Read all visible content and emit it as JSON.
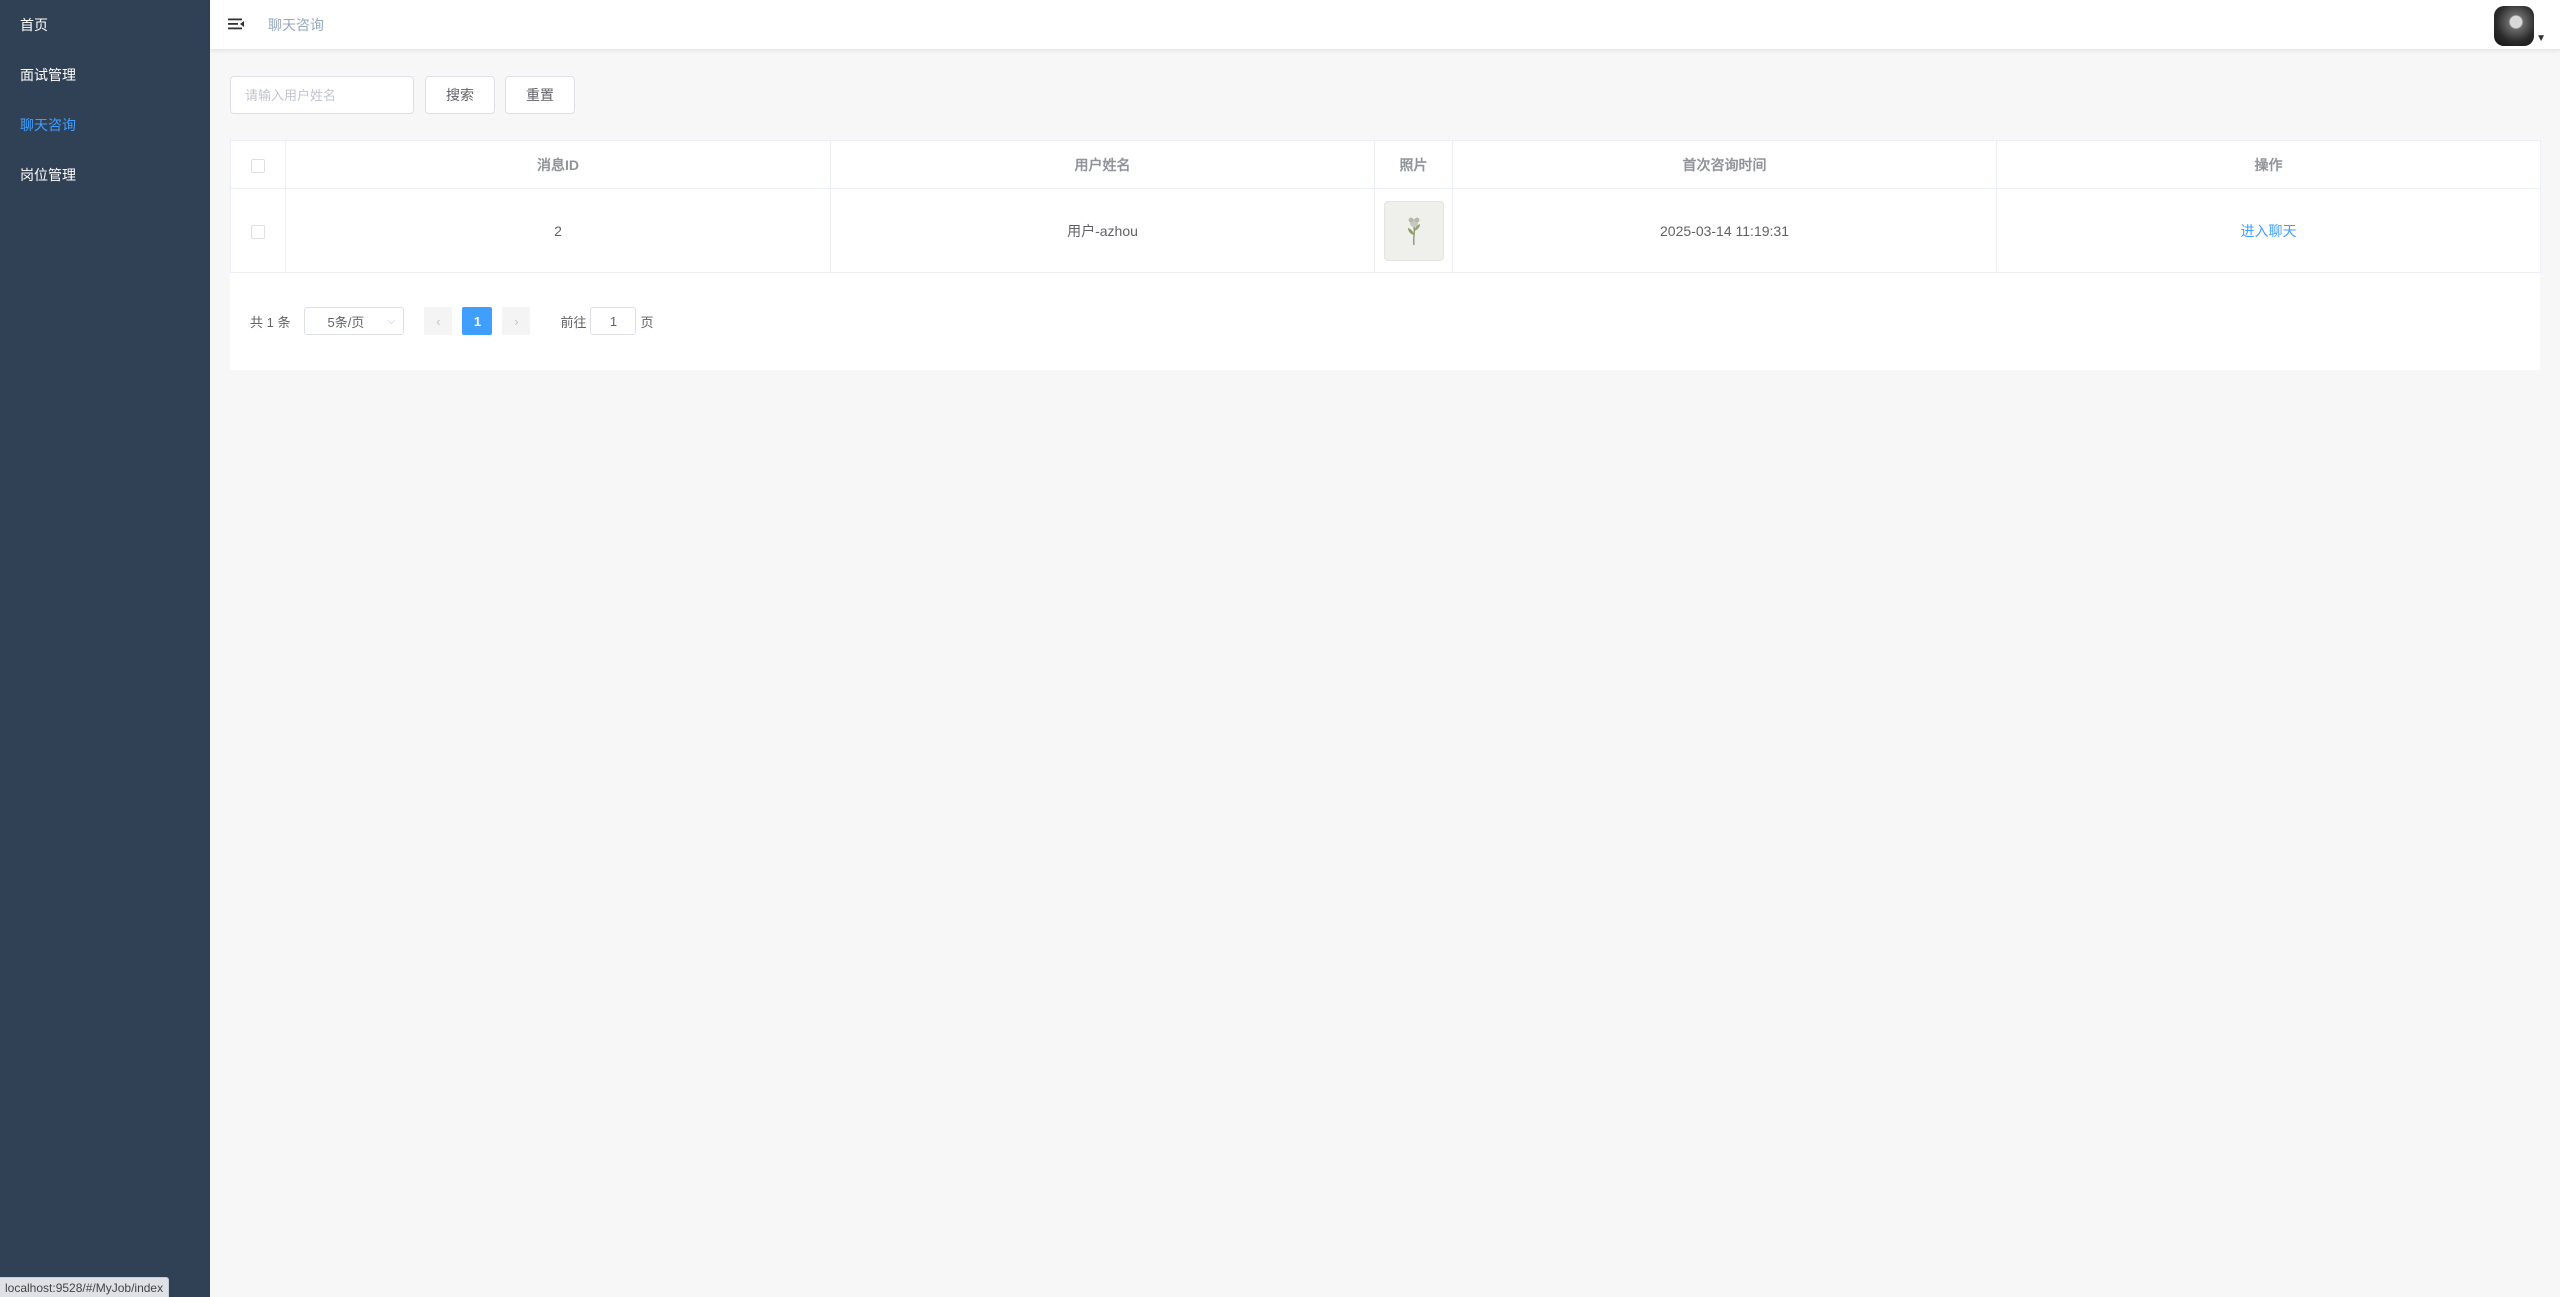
{
  "sidebar": {
    "items": [
      {
        "label": "首页"
      },
      {
        "label": "面试管理"
      },
      {
        "label": "聊天咨询",
        "active": true
      },
      {
        "label": "岗位管理"
      }
    ]
  },
  "navbar": {
    "breadcrumb": "聊天咨询"
  },
  "filter": {
    "search_placeholder": "请输入用户姓名",
    "search_label": "搜索",
    "reset_label": "重置"
  },
  "table": {
    "headers": [
      "消息ID",
      "用户姓名",
      "照片",
      "首次咨询时间",
      "操作"
    ],
    "rows": [
      {
        "id": "2",
        "name": "用户-azhou",
        "time": "2025-03-14 11:19:31",
        "action": "进入聊天"
      }
    ]
  },
  "pagination": {
    "total": "共 1 条",
    "page_size": "5条/页",
    "current_page": "1",
    "goto_label": "前往",
    "goto_value": "1",
    "page_suffix": "页"
  },
  "statusbar": {
    "url": "localhost:9528/#/MyJob/index"
  },
  "colors": {
    "sidebar_bg": "#304156",
    "accent": "#409eff"
  }
}
